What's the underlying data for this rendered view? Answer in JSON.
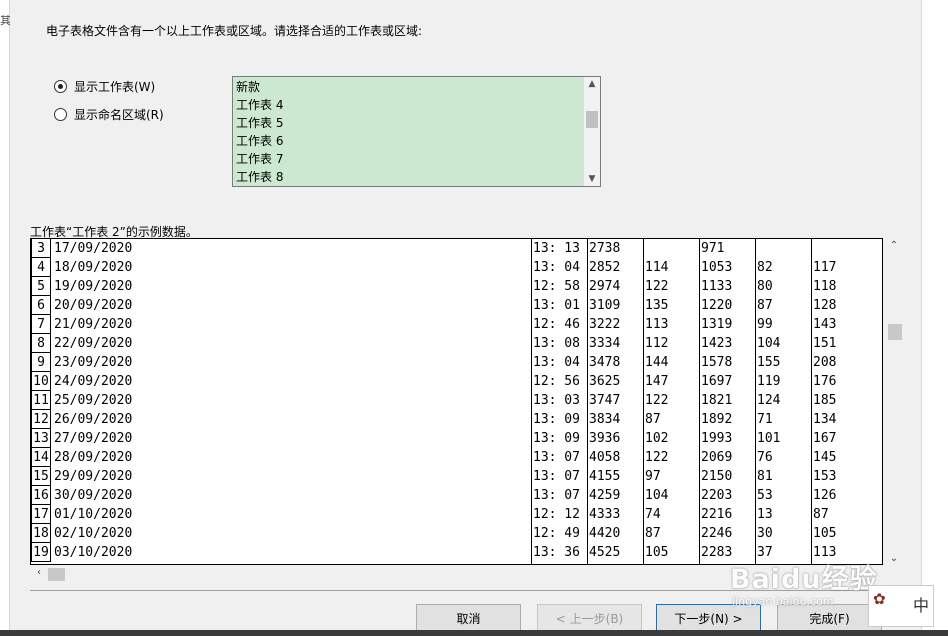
{
  "left_strip_text": "其",
  "dialog": {
    "instruction": "电子表格文件含有一个以上工作表或区域。请选择合适的工作表或区域:",
    "radio_show_sheets": "显示工作表(W)",
    "radio_show_named": "显示命名区域(R)",
    "sheet_list": [
      "新款",
      "工作表 4",
      "工作表 5",
      "工作表 6",
      "工作表 7",
      "工作表 8"
    ],
    "preview_label": "工作表“工作表 2”的示例数据。",
    "preview_rows": [
      [
        "3",
        "17/09/2020",
        "13: 13",
        "2738",
        "",
        "971",
        "",
        ""
      ],
      [
        "4",
        "18/09/2020",
        "13: 04",
        "2852",
        "114",
        "1053",
        "82",
        "117"
      ],
      [
        "5",
        "19/09/2020",
        "12: 58",
        "2974",
        "122",
        "1133",
        "80",
        "118"
      ],
      [
        "6",
        "20/09/2020",
        "13: 01",
        "3109",
        "135",
        "1220",
        "87",
        "128"
      ],
      [
        "7",
        "21/09/2020",
        "12: 46",
        "3222",
        "113",
        "1319",
        "99",
        "143"
      ],
      [
        "8",
        "22/09/2020",
        "13: 08",
        "3334",
        "112",
        "1423",
        "104",
        "151"
      ],
      [
        "9",
        "23/09/2020",
        "13: 04",
        "3478",
        "144",
        "1578",
        "155",
        "208"
      ],
      [
        "10",
        "24/09/2020",
        "12: 56",
        "3625",
        "147",
        "1697",
        "119",
        "176"
      ],
      [
        "11",
        "25/09/2020",
        "13: 03",
        "3747",
        "122",
        "1821",
        "124",
        "185"
      ],
      [
        "12",
        "26/09/2020",
        "13: 09",
        "3834",
        "87",
        "1892",
        "71",
        "134"
      ],
      [
        "13",
        "27/09/2020",
        "13: 09",
        "3936",
        "102",
        "1993",
        "101",
        "167"
      ],
      [
        "14",
        "28/09/2020",
        "13: 07",
        "4058",
        "122",
        "2069",
        "76",
        "145"
      ],
      [
        "15",
        "29/09/2020",
        "13: 07",
        "4155",
        "97",
        "2150",
        "81",
        "153"
      ],
      [
        "16",
        "30/09/2020",
        "13: 07",
        "4259",
        "104",
        "2203",
        "53",
        "126"
      ],
      [
        "17",
        "01/10/2020",
        "12: 12",
        "4333",
        "74",
        "2216",
        "13",
        "87"
      ],
      [
        "18",
        "02/10/2020",
        "12: 49",
        "4420",
        "87",
        "2246",
        "30",
        "105"
      ],
      [
        "19",
        "03/10/2020",
        "13: 36",
        "4525",
        "105",
        "2283",
        "37",
        "113"
      ]
    ],
    "buttons": {
      "cancel": "取消",
      "back": "< 上一步(B)",
      "next": "下一步(N) >",
      "finish": "完成(F)"
    }
  },
  "watermark": {
    "brand": "Baidu经验",
    "url": "jingyan.baidu.com"
  },
  "stamp": {
    "text": "中"
  },
  "icons": {
    "list_up": "chevron-up-icon",
    "list_down": "chevron-down-icon",
    "preview_up": "chevron-up-icon",
    "preview_down": "chevron-down-icon",
    "preview_left": "chevron-left-icon"
  }
}
